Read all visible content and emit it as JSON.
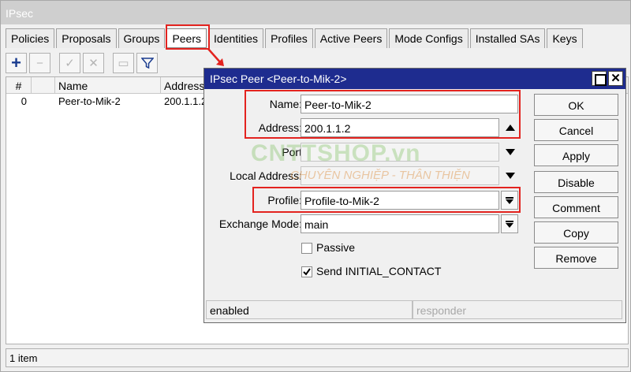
{
  "window": {
    "title": "IPsec"
  },
  "tabs": [
    {
      "label": "Policies"
    },
    {
      "label": "Proposals"
    },
    {
      "label": "Groups"
    },
    {
      "label": "Peers"
    },
    {
      "label": "Identities"
    },
    {
      "label": "Profiles"
    },
    {
      "label": "Active Peers"
    },
    {
      "label": "Mode Configs"
    },
    {
      "label": "Installed SAs"
    },
    {
      "label": "Keys"
    }
  ],
  "toolbar": {
    "add": "+",
    "remove": "−",
    "enable": "✓",
    "disable": "✕",
    "comment": "▭",
    "filter": "filter-icon"
  },
  "table": {
    "columns": [
      "#",
      "Name",
      "Address"
    ],
    "rows": [
      {
        "num": "0",
        "name": "Peer-to-Mik-2",
        "address": "200.1.1.2"
      }
    ]
  },
  "status": {
    "count": "1 item"
  },
  "dialog": {
    "title": "IPsec Peer <Peer-to-Mik-2>",
    "fields": {
      "name_label": "Name:",
      "name_value": "Peer-to-Mik-2",
      "address_label": "Address:",
      "address_value": "200.1.1.2",
      "port_label": "Port",
      "local_address_label": "Local Address:",
      "profile_label": "Profile:",
      "profile_value": "Profile-to-Mik-2",
      "exchange_mode_label": "Exchange Mode:",
      "exchange_mode_value": "main",
      "passive_label": "Passive",
      "passive_checked": false,
      "initial_contact_label": "Send INITIAL_CONTACT",
      "initial_contact_checked": true
    },
    "buttons": {
      "ok": "OK",
      "cancel": "Cancel",
      "apply": "Apply",
      "disable": "Disable",
      "comment": "Comment",
      "copy": "Copy",
      "remove": "Remove"
    },
    "status": {
      "state": "enabled",
      "role": "responder"
    }
  },
  "watermark": {
    "brand": "CNTTSHOP.vn",
    "tagline": "CHUYÊN NGHIỆP - THÂN THIỆN"
  },
  "highlight_color": "#e3231f"
}
